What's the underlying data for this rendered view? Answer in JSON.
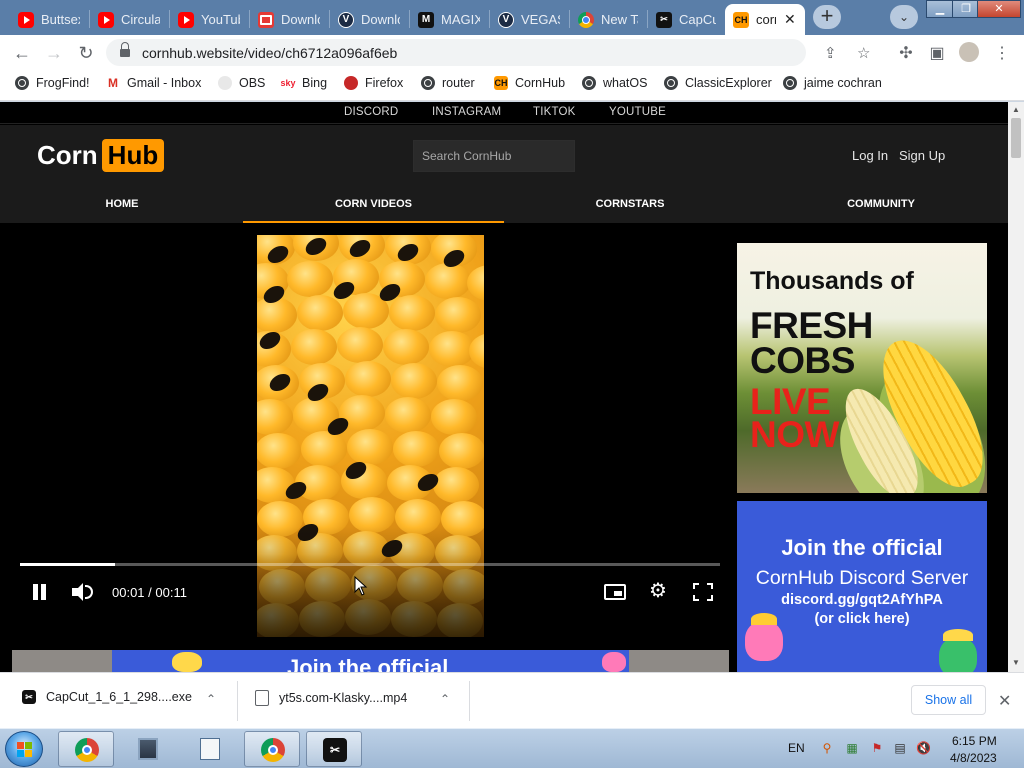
{
  "browser": {
    "tabs": [
      {
        "title": "Buttsex",
        "favicon": "youtube-icon"
      },
      {
        "title": "Circular",
        "favicon": "youtube-icon"
      },
      {
        "title": "YouTube",
        "favicon": "youtube-icon"
      },
      {
        "title": "Downloader",
        "favicon": "downloader-icon"
      },
      {
        "title": "Downloader",
        "favicon": "vegas-icon"
      },
      {
        "title": "MAGIX",
        "favicon": "magix-icon"
      },
      {
        "title": "VEGAS",
        "favicon": "vegas-icon"
      },
      {
        "title": "New Tab",
        "favicon": "chrome-icon"
      },
      {
        "title": "CapCut",
        "favicon": "capcut-icon"
      },
      {
        "title": "corn",
        "favicon": "cornhub-icon",
        "active": true
      }
    ],
    "url": "cornhub.website/video/ch6712a096af6eb",
    "bookmarks": [
      {
        "label": "FrogFind!",
        "icon": "globe-icon"
      },
      {
        "label": "Gmail - Inbox",
        "icon": "gmail-icon"
      },
      {
        "label": "OBS",
        "icon": "github-icon"
      },
      {
        "label": "Bing",
        "icon": "bing-icon"
      },
      {
        "label": "Firefox",
        "icon": "firefox-icon"
      },
      {
        "label": "router",
        "icon": "globe-icon"
      },
      {
        "label": "CornHub",
        "icon": "cornhub-icon"
      },
      {
        "label": "whatOS",
        "icon": "globe-icon"
      },
      {
        "label": "ClassicExplorer",
        "icon": "globe-icon"
      },
      {
        "label": "jaime cochran",
        "icon": "globe-icon"
      }
    ]
  },
  "site": {
    "social_links": [
      "DISCORD",
      "INSTAGRAM",
      "TIKTOK",
      "YOUTUBE"
    ],
    "logo": {
      "part1": "Corn",
      "part2": "Hub"
    },
    "search_placeholder": "Search CornHub",
    "login": "Log In",
    "signup": "Sign Up",
    "nav": [
      {
        "label": "HOME"
      },
      {
        "label": "CORN VIDEOS",
        "active": true
      },
      {
        "label": "CORNSTARS"
      },
      {
        "label": "COMMUNITY"
      }
    ],
    "accent_color": "#ff9900"
  },
  "player": {
    "time_display": "00:01 / 00:11",
    "progress_fraction": 0.135,
    "state": "playing"
  },
  "ads": {
    "ad1": {
      "line1": "Thousands of",
      "line2": "FRESH",
      "line3": "COBS",
      "line4": "LIVE",
      "line5": "NOW"
    },
    "ad2": {
      "line1": "Join the official",
      "line2": "CornHub Discord Server",
      "line3": "discord.gg/gqt2AfYhPA",
      "line4": "(or click here)"
    },
    "banner_text": "Join the official"
  },
  "downloads": {
    "items": [
      {
        "name": "CapCut_1_6_1_298....exe"
      },
      {
        "name": "yt5s.com-Klasky....mp4"
      }
    ],
    "show_all": "Show all"
  },
  "taskbar": {
    "language": "EN",
    "time": "6:15 PM",
    "date": "4/8/2023"
  }
}
